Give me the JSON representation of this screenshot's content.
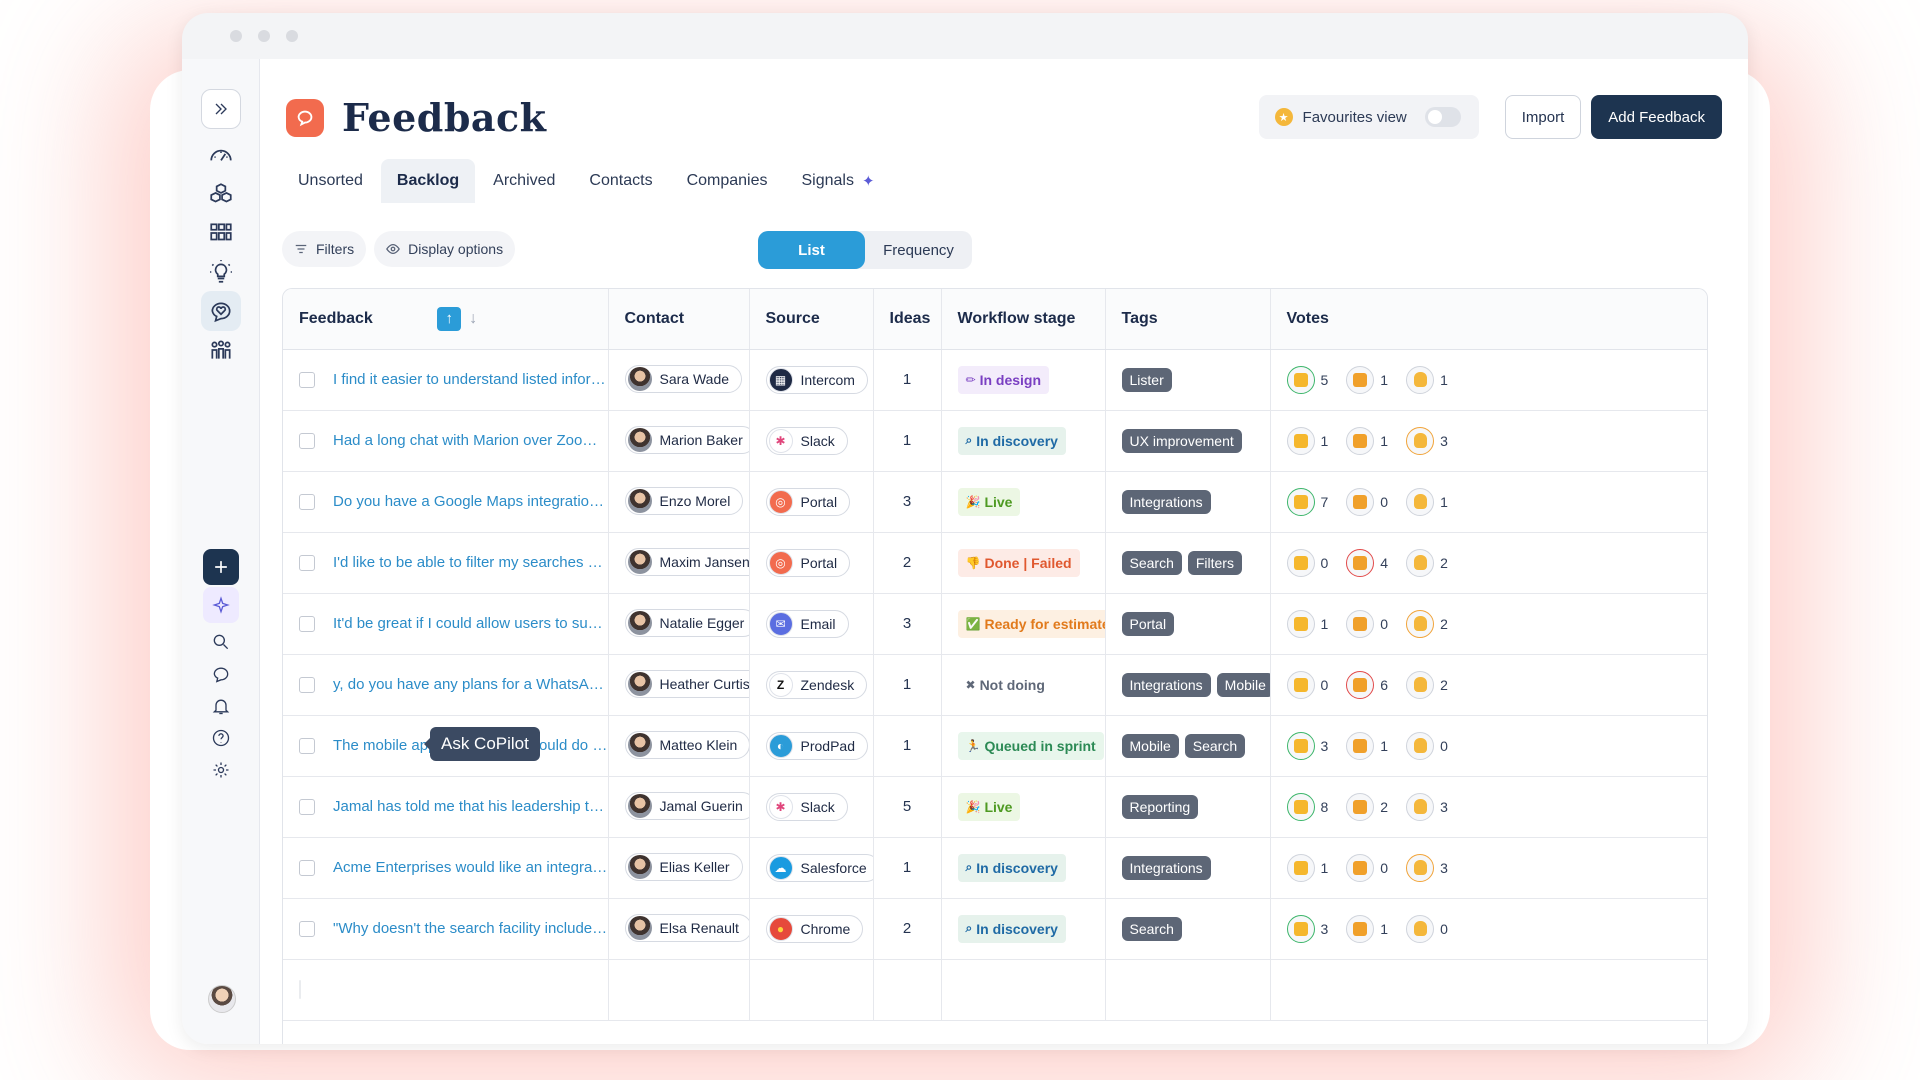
{
  "app": {
    "page_title": "Feedback",
    "favourites_label": "Favourites view",
    "import_label": "Import",
    "add_label": "Add Feedback",
    "tooltip": "Ask CoPilot"
  },
  "tabs": [
    "Unsorted",
    "Backlog",
    "Archived",
    "Contacts",
    "Companies",
    "Signals"
  ],
  "active_tab": "Backlog",
  "toolbar": {
    "filters": "Filters",
    "display": "Display options",
    "view_list": "List",
    "view_frequency": "Frequency"
  },
  "columns": [
    "Feedback",
    "Contact",
    "Source",
    "Ideas",
    "Workflow stage",
    "Tags",
    "Votes"
  ],
  "colors": {
    "accent": "#2b9cd8",
    "brand": "#f26b4e",
    "navy": "#1d3450"
  },
  "rows": [
    {
      "text": "I find it easier to understand listed informatio...",
      "contact": "Sara Wade",
      "source": "Intercom",
      "src_icon": "intercom-icon",
      "ideas": "1",
      "stage": "In design",
      "stage_kind": "design",
      "tags": [
        "Lister"
      ],
      "up": "5",
      "down": "1",
      "hand": "1",
      "up_c": "g",
      "down_c": "",
      "hand_c": ""
    },
    {
      "text": "Had a long chat with Marion over Zoom. She i...",
      "contact": "Marion Baker",
      "source": "Slack",
      "src_icon": "slack-icon",
      "ideas": "1",
      "stage": "In discovery",
      "stage_kind": "discovery",
      "tags": [
        "UX improvement"
      ],
      "up": "1",
      "down": "1",
      "hand": "3",
      "up_c": "",
      "down_c": "",
      "hand_c": "o"
    },
    {
      "text": "Do you have a Google Maps integration? I ne...",
      "contact": "Enzo Morel",
      "source": "Portal",
      "src_icon": "portal-icon",
      "ideas": "3",
      "stage": "Live",
      "stage_kind": "live",
      "tags": [
        "Integrations"
      ],
      "up": "7",
      "down": "0",
      "hand": "1",
      "up_c": "g",
      "down_c": "",
      "hand_c": ""
    },
    {
      "text": "I'd like to be able to filter my searches based...",
      "contact": "Maxim Jansen",
      "source": "Portal",
      "src_icon": "portal-icon",
      "ideas": "2",
      "stage": "Done | Failed",
      "stage_kind": "failed",
      "tags": [
        "Search",
        "Filters"
      ],
      "up": "0",
      "down": "4",
      "hand": "2",
      "up_c": "",
      "down_c": "r",
      "hand_c": ""
    },
    {
      "text": "It'd be great if I could allow users to submit t...",
      "contact": "Natalie Egger",
      "source": "Email",
      "src_icon": "email-icon",
      "ideas": "3",
      "stage": "Ready for estimate",
      "stage_kind": "ready",
      "tags": [
        "Portal"
      ],
      "up": "1",
      "down": "0",
      "hand": "2",
      "up_c": "",
      "down_c": "",
      "hand_c": "o"
    },
    {
      "text": "y, do you have any plans for a WhatsApp i...",
      "contact": "Heather Curtis",
      "source": "Zendesk",
      "src_icon": "zendesk-icon",
      "ideas": "1",
      "stage": "Not doing",
      "stage_kind": "notdoing",
      "tags": [
        "Integrations",
        "Mobile"
      ],
      "up": "0",
      "down": "6",
      "hand": "2",
      "up_c": "",
      "down_c": "r",
      "hand_c": ""
    },
    {
      "text": "The mobile app is great, but I could do with b...",
      "contact": "Matteo Klein",
      "source": "ProdPad",
      "src_icon": "prodpad-icon",
      "ideas": "1",
      "stage": "Queued in sprint",
      "stage_kind": "queued",
      "tags": [
        "Mobile",
        "Search"
      ],
      "up": "3",
      "down": "1",
      "hand": "0",
      "up_c": "g",
      "down_c": "",
      "hand_c": ""
    },
    {
      "text": "Jamal has told me that his leadership team ar...",
      "contact": "Jamal Guerin",
      "source": "Slack",
      "src_icon": "slack-icon",
      "ideas": "5",
      "stage": "Live",
      "stage_kind": "live",
      "tags": [
        "Reporting"
      ],
      "up": "8",
      "down": "2",
      "hand": "3",
      "up_c": "g",
      "down_c": "",
      "hand_c": ""
    },
    {
      "text": "Acme Enterprises would like an integration w...",
      "contact": "Elias Keller",
      "source": "Salesforce",
      "src_icon": "salesforce-icon",
      "ideas": "1",
      "stage": "In discovery",
      "stage_kind": "discovery",
      "tags": [
        "Integrations"
      ],
      "up": "1",
      "down": "0",
      "hand": "3",
      "up_c": "",
      "down_c": "",
      "hand_c": "o"
    },
    {
      "text": "\"Why doesn't the search facility include both...",
      "contact": "Elsa Renault",
      "source": "Chrome",
      "src_icon": "chrome-icon",
      "ideas": "2",
      "stage": "In discovery",
      "stage_kind": "discovery",
      "tags": [
        "Search"
      ],
      "up": "3",
      "down": "1",
      "hand": "0",
      "up_c": "g",
      "down_c": "",
      "hand_c": ""
    }
  ]
}
